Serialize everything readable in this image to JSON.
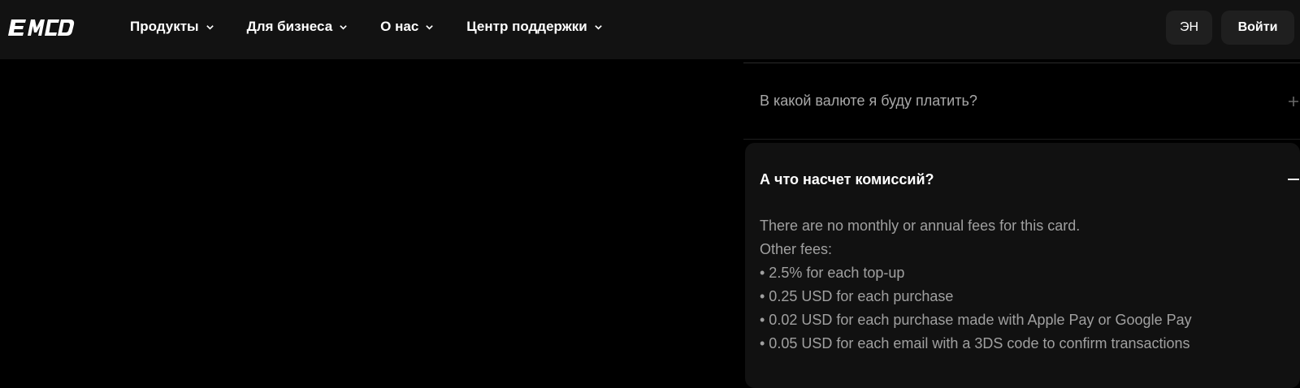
{
  "header": {
    "logo_text": "EMCD",
    "nav": [
      {
        "label": "Продукты"
      },
      {
        "label": "Для бизнеса"
      },
      {
        "label": "О нас"
      },
      {
        "label": "Центр поддержки"
      }
    ],
    "lang_label": "ЭН",
    "login_label": "Войти"
  },
  "faq": {
    "collapsed_question": "В какой валюте я буду платить?",
    "open_question": "А что насчет комиссий?",
    "answer": {
      "intro": "There are no monthly or annual fees for this card.",
      "other_fees_label": "Other fees:",
      "items": [
        "• 2.5% for each top-up",
        "• 0.25 USD for each purchase",
        "• 0.02 USD for each purchase made with Apple Pay or Google Pay",
        "• 0.05 USD for each email with a 3DS code to confirm transactions"
      ]
    }
  },
  "colors": {
    "page_bg": "#000000",
    "header_bg": "#121212",
    "button_bg": "#1f1f1f",
    "card_bg": "#111111",
    "muted_text": "#a0a0a0"
  },
  "icons": {
    "logo": "emcd-logo",
    "nav_chevron": "chevron-down-icon",
    "expand": "plus-icon",
    "collapse": "minus-icon"
  }
}
